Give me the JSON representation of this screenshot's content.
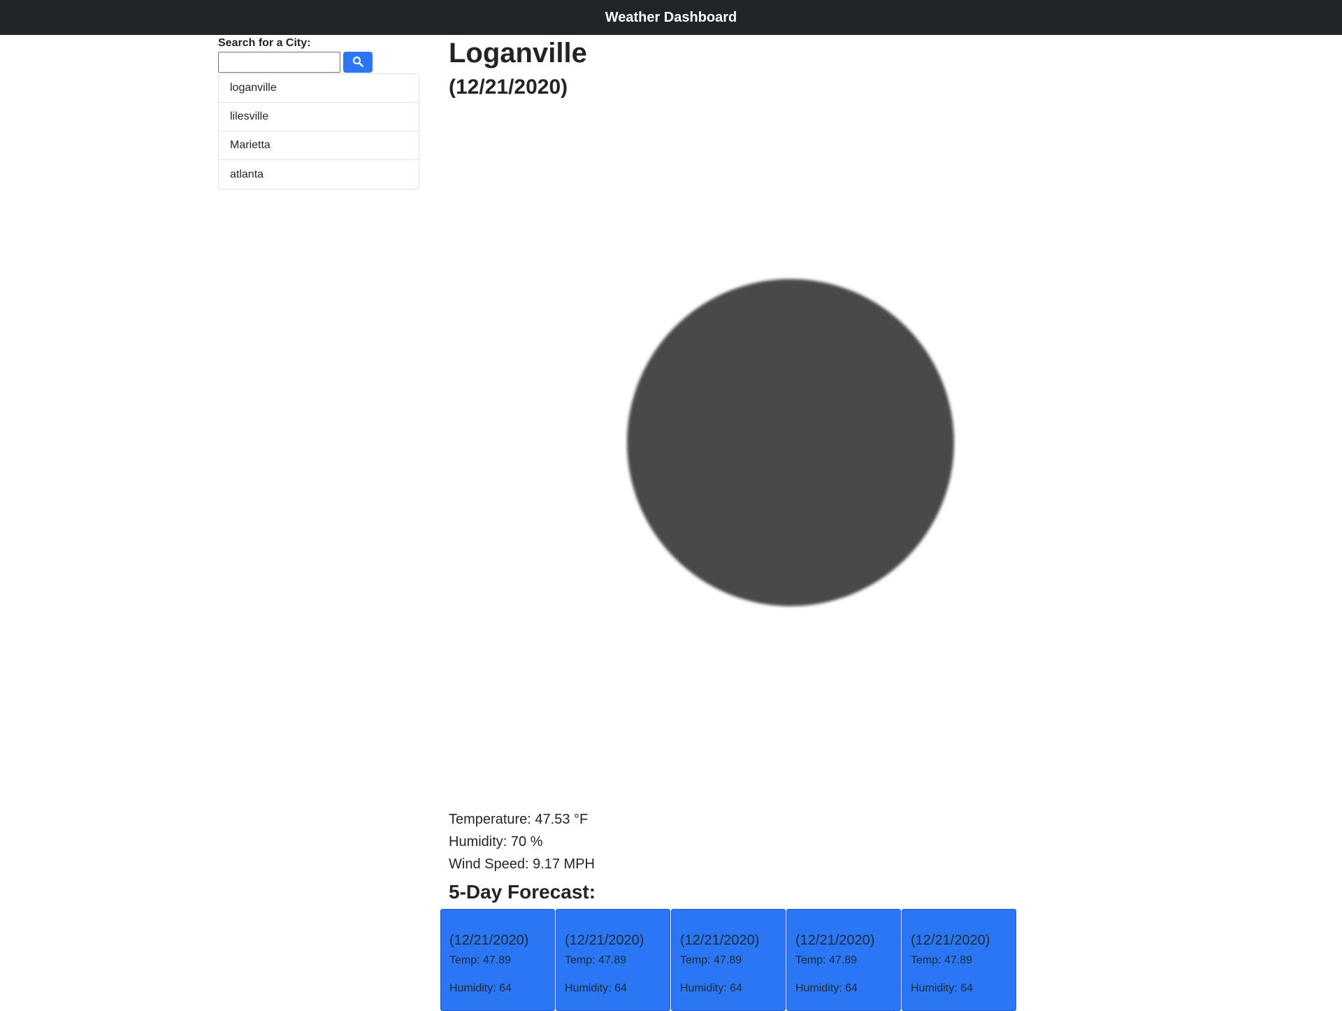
{
  "header": {
    "title": "Weather Dashboard"
  },
  "sidebar": {
    "search_label": "Search for a City:",
    "search_value": "",
    "search_placeholder": "",
    "search_button_icon": "search-icon",
    "history": [
      {
        "label": "loganville"
      },
      {
        "label": "lilesville"
      },
      {
        "label": "Marietta"
      },
      {
        "label": "atlanta"
      }
    ]
  },
  "current": {
    "city": "Loganville",
    "date": "(12/21/2020)",
    "icon": "dark-circle-weather-icon",
    "temperature": "Temperature: 47.53 °F",
    "humidity": "Humidity: 70 %",
    "wind_speed": "Wind Speed: 9.17 MPH"
  },
  "forecast": {
    "heading": "5-Day Forecast:",
    "days": [
      {
        "date": "(12/21/2020)",
        "temp": "Temp: 47.89",
        "humidity": "Humidity: 64"
      },
      {
        "date": "(12/21/2020)",
        "temp": "Temp: 47.89",
        "humidity": "Humidity: 64"
      },
      {
        "date": "(12/21/2020)",
        "temp": "Temp: 47.89",
        "humidity": "Humidity: 64"
      },
      {
        "date": "(12/21/2020)",
        "temp": "Temp: 47.89",
        "humidity": "Humidity: 64"
      },
      {
        "date": "(12/21/2020)",
        "temp": "Temp: 47.89",
        "humidity": "Humidity: 64"
      }
    ]
  },
  "colors": {
    "navbar_bg": "#212529",
    "accent": "#2b76f5",
    "icon_fill": "#48484a"
  }
}
